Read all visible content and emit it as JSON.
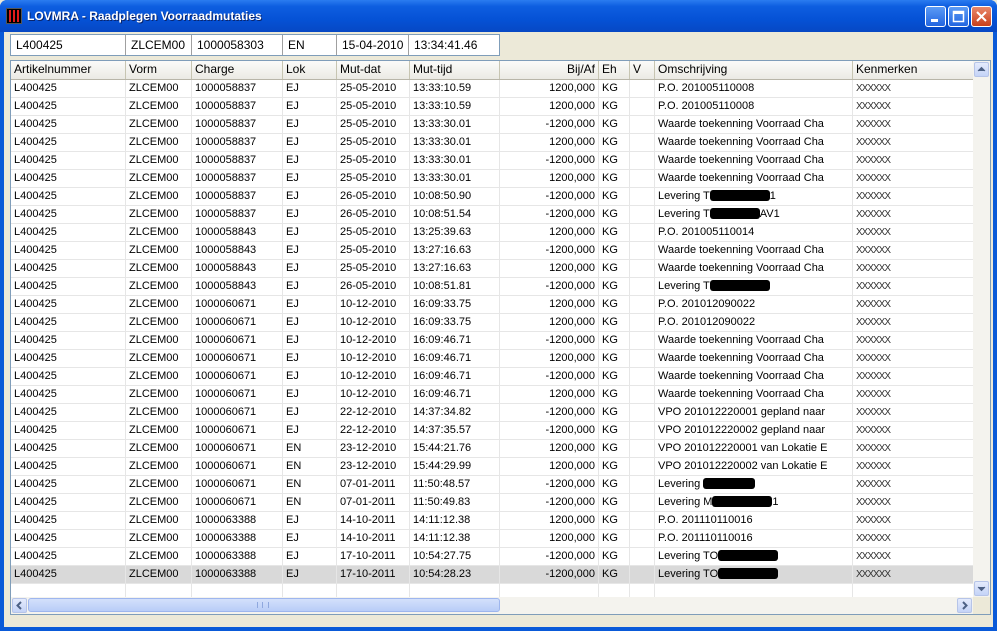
{
  "window": {
    "title": "LOVMRA - Raadplegen Voorraadmutaties"
  },
  "infobar": [
    "L400425",
    "ZLCEM00",
    "1000058303",
    "EN",
    "15-04-2010",
    "13:34:41.46"
  ],
  "columns": [
    "Artikelnummer",
    "Vorm",
    "Charge",
    "Lok",
    "Mut-dat",
    "Mut-tijd",
    "Bij/Af",
    "Eh",
    "V",
    "Omschrijving",
    "Kenmerken"
  ],
  "rows": [
    [
      "L400425",
      "ZLCEM00",
      "1000058837",
      "EJ",
      "25-05-2010",
      "13:33:10.59",
      "1200,000",
      "KG",
      "",
      "P.O. 201005110008",
      "XXXXXX"
    ],
    [
      "L400425",
      "ZLCEM00",
      "1000058837",
      "EJ",
      "25-05-2010",
      "13:33:10.59",
      "1200,000",
      "KG",
      "",
      "P.O. 201005110008",
      "XXXXXX"
    ],
    [
      "L400425",
      "ZLCEM00",
      "1000058837",
      "EJ",
      "25-05-2010",
      "13:33:30.01",
      "-1200,000",
      "KG",
      "",
      "Waarde toekenning Voorraad Cha",
      "XXXXXX"
    ],
    [
      "L400425",
      "ZLCEM00",
      "1000058837",
      "EJ",
      "25-05-2010",
      "13:33:30.01",
      "1200,000",
      "KG",
      "",
      "Waarde toekenning Voorraad Cha",
      "XXXXXX"
    ],
    [
      "L400425",
      "ZLCEM00",
      "1000058837",
      "EJ",
      "25-05-2010",
      "13:33:30.01",
      "-1200,000",
      "KG",
      "",
      "Waarde toekenning Voorraad Cha",
      "XXXXXX"
    ],
    [
      "L400425",
      "ZLCEM00",
      "1000058837",
      "EJ",
      "25-05-2010",
      "13:33:30.01",
      "1200,000",
      "KG",
      "",
      "Waarde toekenning Voorraad Cha",
      "XXXXXX"
    ],
    [
      "L400425",
      "ZLCEM00",
      "1000058837",
      "EJ",
      "26-05-2010",
      "10:08:50.90",
      "-1200,000",
      "KG",
      "",
      "Levering T|1",
      "XXXXXX"
    ],
    [
      "L400425",
      "ZLCEM00",
      "1000058837",
      "EJ",
      "26-05-2010",
      "10:08:51.54",
      "-1200,000",
      "KG",
      "",
      "Levering T|AV1",
      "XXXXXX"
    ],
    [
      "L400425",
      "ZLCEM00",
      "1000058843",
      "EJ",
      "25-05-2010",
      "13:25:39.63",
      "1200,000",
      "KG",
      "",
      "P.O. 201005110014",
      "XXXXXX"
    ],
    [
      "L400425",
      "ZLCEM00",
      "1000058843",
      "EJ",
      "25-05-2010",
      "13:27:16.63",
      "-1200,000",
      "KG",
      "",
      "Waarde toekenning Voorraad Cha",
      "XXXXXX"
    ],
    [
      "L400425",
      "ZLCEM00",
      "1000058843",
      "EJ",
      "25-05-2010",
      "13:27:16.63",
      "1200,000",
      "KG",
      "",
      "Waarde toekenning Voorraad Cha",
      "XXXXXX"
    ],
    [
      "L400425",
      "ZLCEM00",
      "1000058843",
      "EJ",
      "26-05-2010",
      "10:08:51.81",
      "-1200,000",
      "KG",
      "",
      "Levering T|",
      "XXXXXX"
    ],
    [
      "L400425",
      "ZLCEM00",
      "1000060671",
      "EJ",
      "10-12-2010",
      "16:09:33.75",
      "1200,000",
      "KG",
      "",
      "P.O. 201012090022",
      "XXXXXX"
    ],
    [
      "L400425",
      "ZLCEM00",
      "1000060671",
      "EJ",
      "10-12-2010",
      "16:09:33.75",
      "1200,000",
      "KG",
      "",
      "P.O. 201012090022",
      "XXXXXX"
    ],
    [
      "L400425",
      "ZLCEM00",
      "1000060671",
      "EJ",
      "10-12-2010",
      "16:09:46.71",
      "-1200,000",
      "KG",
      "",
      "Waarde toekenning Voorraad Cha",
      "XXXXXX"
    ],
    [
      "L400425",
      "ZLCEM00",
      "1000060671",
      "EJ",
      "10-12-2010",
      "16:09:46.71",
      "1200,000",
      "KG",
      "",
      "Waarde toekenning Voorraad Cha",
      "XXXXXX"
    ],
    [
      "L400425",
      "ZLCEM00",
      "1000060671",
      "EJ",
      "10-12-2010",
      "16:09:46.71",
      "-1200,000",
      "KG",
      "",
      "Waarde toekenning Voorraad Cha",
      "XXXXXX"
    ],
    [
      "L400425",
      "ZLCEM00",
      "1000060671",
      "EJ",
      "10-12-2010",
      "16:09:46.71",
      "1200,000",
      "KG",
      "",
      "Waarde toekenning Voorraad Cha",
      "XXXXXX"
    ],
    [
      "L400425",
      "ZLCEM00",
      "1000060671",
      "EJ",
      "22-12-2010",
      "14:37:34.82",
      "-1200,000",
      "KG",
      "",
      "VPO 201012220001 gepland naar",
      "XXXXXX"
    ],
    [
      "L400425",
      "ZLCEM00",
      "1000060671",
      "EJ",
      "22-12-2010",
      "14:37:35.57",
      "-1200,000",
      "KG",
      "",
      "VPO 201012220002 gepland naar",
      "XXXXXX"
    ],
    [
      "L400425",
      "ZLCEM00",
      "1000060671",
      "EN",
      "23-12-2010",
      "15:44:21.76",
      "1200,000",
      "KG",
      "",
      "VPO 201012220001 van Lokatie E",
      "XXXXXX"
    ],
    [
      "L400425",
      "ZLCEM00",
      "1000060671",
      "EN",
      "23-12-2010",
      "15:44:29.99",
      "1200,000",
      "KG",
      "",
      "VPO 201012220002 van Lokatie E",
      "XXXXXX"
    ],
    [
      "L400425",
      "ZLCEM00",
      "1000060671",
      "EN",
      "07-01-2011",
      "11:50:48.57",
      "-1200,000",
      "KG",
      "",
      "Levering |",
      "XXXXXX"
    ],
    [
      "L400425",
      "ZLCEM00",
      "1000060671",
      "EN",
      "07-01-2011",
      "11:50:49.83",
      "-1200,000",
      "KG",
      "",
      "Levering M|1",
      "XXXXXX"
    ],
    [
      "L400425",
      "ZLCEM00",
      "1000063388",
      "EJ",
      "14-10-2011",
      "14:11:12.38",
      "1200,000",
      "KG",
      "",
      "P.O. 201110110016",
      "XXXXXX"
    ],
    [
      "L400425",
      "ZLCEM00",
      "1000063388",
      "EJ",
      "14-10-2011",
      "14:11:12.38",
      "1200,000",
      "KG",
      "",
      "P.O. 201110110016",
      "XXXXXX"
    ],
    [
      "L400425",
      "ZLCEM00",
      "1000063388",
      "EJ",
      "17-10-2011",
      "10:54:27.75",
      "-1200,000",
      "KG",
      "",
      "Levering TO|",
      "XXXXXX"
    ],
    [
      "L400425",
      "ZLCEM00",
      "1000063388",
      "EJ",
      "17-10-2011",
      "10:54:28.23",
      "-1200,000",
      "KG",
      "",
      "Levering TO|",
      "XXXXXX"
    ]
  ],
  "selected_row": 27
}
